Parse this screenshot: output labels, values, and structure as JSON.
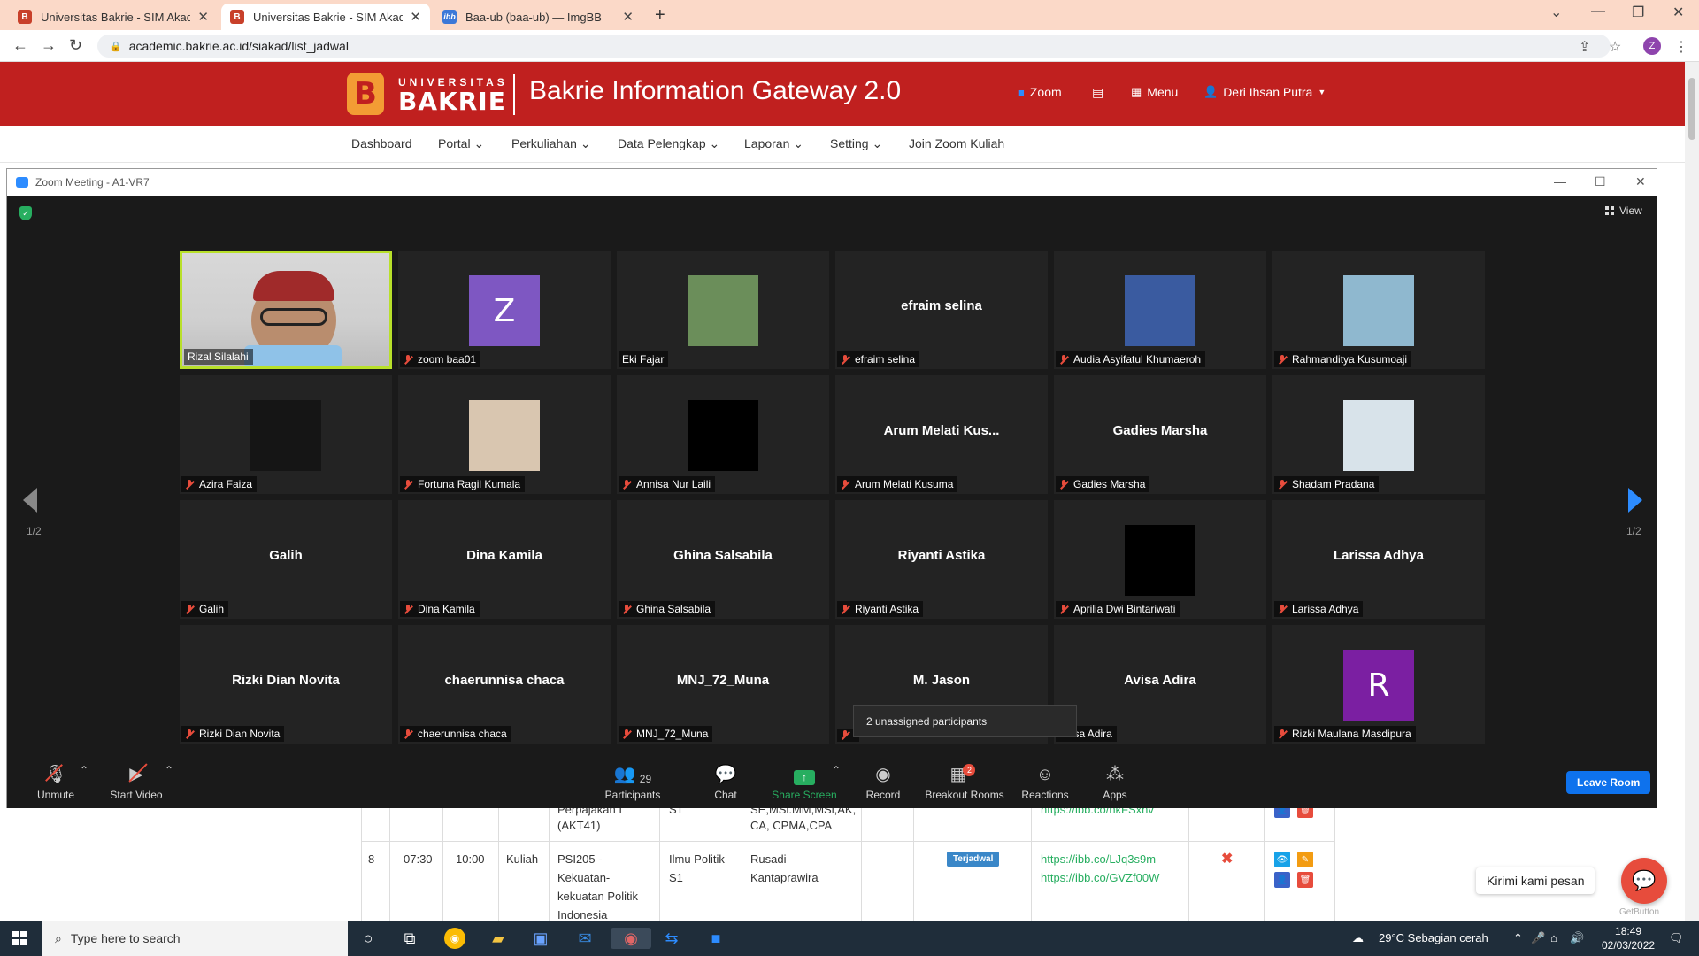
{
  "browser": {
    "tabs": [
      {
        "title": "Universitas Bakrie - SIM Akadem"
      },
      {
        "title": "Universitas Bakrie - SIM Akadem"
      },
      {
        "title": "Baa-ub (baa-ub) — ImgBB"
      }
    ],
    "url": "academic.bakrie.ac.id/siakad/list_jadwal",
    "profile_initial": "Z"
  },
  "site": {
    "logo_top": "UNIVERSITAS",
    "logo_main": "BAKRIE",
    "logo_letter": "B",
    "title": "Bakrie Information Gateway 2.0",
    "header_links": {
      "zoom": "Zoom",
      "menu": "Menu",
      "user": "Deri Ihsan Putra"
    },
    "menu": [
      "Dashboard",
      "Portal",
      "Perkuliahan",
      "Data Pelengkap",
      "Laporan",
      "Setting",
      "Join Zoom Kuliah"
    ]
  },
  "zoom": {
    "window_title": "Zoom Meeting - A1-VR7",
    "view_label": "View",
    "page_left": "1/2",
    "page_right": "1/2",
    "tiles": [
      {
        "label": "Rizal Silalahi",
        "kind": "camera",
        "muted": false,
        "active": true
      },
      {
        "label": "zoom baa01",
        "kind": "avatar",
        "avatar_text": "Z",
        "avatar_color": "#7e57c2",
        "muted": true
      },
      {
        "label": "Eki Fajar",
        "kind": "photo",
        "photo_color": "#6b8e5a",
        "muted": false
      },
      {
        "label": "efraim selina",
        "kind": "name",
        "big_name": "efraim selina",
        "muted": true
      },
      {
        "label": "Audia Asyifatul Khumaeroh",
        "kind": "photo",
        "photo_color": "#3a5ba0",
        "muted": true
      },
      {
        "label": "Rahmanditya Kusumoaji",
        "kind": "photo",
        "photo_color": "#8fb8cf",
        "muted": true
      },
      {
        "label": "Azira Faiza",
        "kind": "photo",
        "photo_color": "#151515",
        "muted": true
      },
      {
        "label": "Fortuna Ragil Kumala",
        "kind": "photo",
        "photo_color": "#d9c6b0",
        "muted": true
      },
      {
        "label": "Annisa Nur Laili",
        "kind": "photo",
        "photo_color": "#000000",
        "muted": true
      },
      {
        "label": "Arum Melati Kusuma",
        "kind": "name",
        "big_name": "Arum  Melati  Kus...",
        "muted": true
      },
      {
        "label": "Gadies Marsha",
        "kind": "name",
        "big_name": "Gadies Marsha",
        "muted": true
      },
      {
        "label": "Shadam Pradana",
        "kind": "photo",
        "photo_color": "#d8e3ea",
        "muted": true
      },
      {
        "label": "Galih",
        "kind": "name",
        "big_name": "Galih",
        "muted": true
      },
      {
        "label": "Dina Kamila",
        "kind": "name",
        "big_name": "Dina Kamila",
        "muted": true
      },
      {
        "label": "Ghina Salsabila",
        "kind": "name",
        "big_name": "Ghina Salsabila",
        "muted": true
      },
      {
        "label": "Riyanti Astika",
        "kind": "name",
        "big_name": "Riyanti Astika",
        "muted": true
      },
      {
        "label": "Aprilia Dwi Bintariwati",
        "kind": "photo",
        "photo_color": "#000000",
        "muted": true
      },
      {
        "label": "Larissa Adhya",
        "kind": "name",
        "big_name": "Larissa Adhya",
        "muted": true
      },
      {
        "label": "Rizki Dian Novita",
        "kind": "name",
        "big_name": "Rizki Dian Novita",
        "muted": true
      },
      {
        "label": "chaerunnisa chaca",
        "kind": "name",
        "big_name": "chaerunnisa chaca",
        "muted": true
      },
      {
        "label": "MNJ_72_Muna",
        "kind": "name",
        "big_name": "MNJ_72_Muna",
        "muted": true
      },
      {
        "label": "",
        "kind": "name",
        "big_name": "M. Jason",
        "muted": true
      },
      {
        "label": "Avisa Adira",
        "kind": "name",
        "big_name": "Avisa Adira",
        "muted": false
      },
      {
        "label": "Rizki Maulana Masdipura",
        "kind": "avatar",
        "avatar_text": "R",
        "avatar_color": "#7b1fa2",
        "muted": true
      }
    ],
    "unassigned_tooltip": "2 unassigned participants",
    "toolbar": {
      "unmute": "Unmute",
      "start_video": "Start Video",
      "participants": "Participants",
      "participants_count": "29",
      "chat": "Chat",
      "share_screen": "Share Screen",
      "record": "Record",
      "breakout_rooms": "Breakout Rooms",
      "breakout_badge": "2",
      "reactions": "Reactions",
      "apps": "Apps",
      "leave_room": "Leave Room"
    }
  },
  "schedule": {
    "partial_row": {
      "course_a": "Perpajakan I",
      "course_b": "(AKT41)",
      "prodi": "S1",
      "lecturer_a": "SE,MSi.MM,MSi,AK,",
      "lecturer_b": "CA, CPMA,CPA",
      "link": "https://ibb.co/nkFSxnv"
    },
    "row": {
      "no": "8",
      "start": "07:30",
      "end": "10:00",
      "type": "Kuliah",
      "course_1": "PSI205 -",
      "course_2": "Kekuatan-",
      "course_3": "kekuatan Politik",
      "course_4": "Indonesia",
      "prodi_1": "Ilmu Politik",
      "prodi_2": "S1",
      "lecturer_1": "Rusadi",
      "lecturer_2": "Kantaprawira",
      "status": "Terjadwal",
      "link_1": "https://ibb.co/LJq3s9m",
      "link_2": "https://ibb.co/GVZf00W"
    }
  },
  "widget": {
    "message": "Kirimi kami pesan",
    "brand": "GetButton"
  },
  "taskbar": {
    "search_placeholder": "Type here to search",
    "weather": "29°C  Sebagian cerah",
    "time": "18:49",
    "date": "02/03/2022"
  }
}
